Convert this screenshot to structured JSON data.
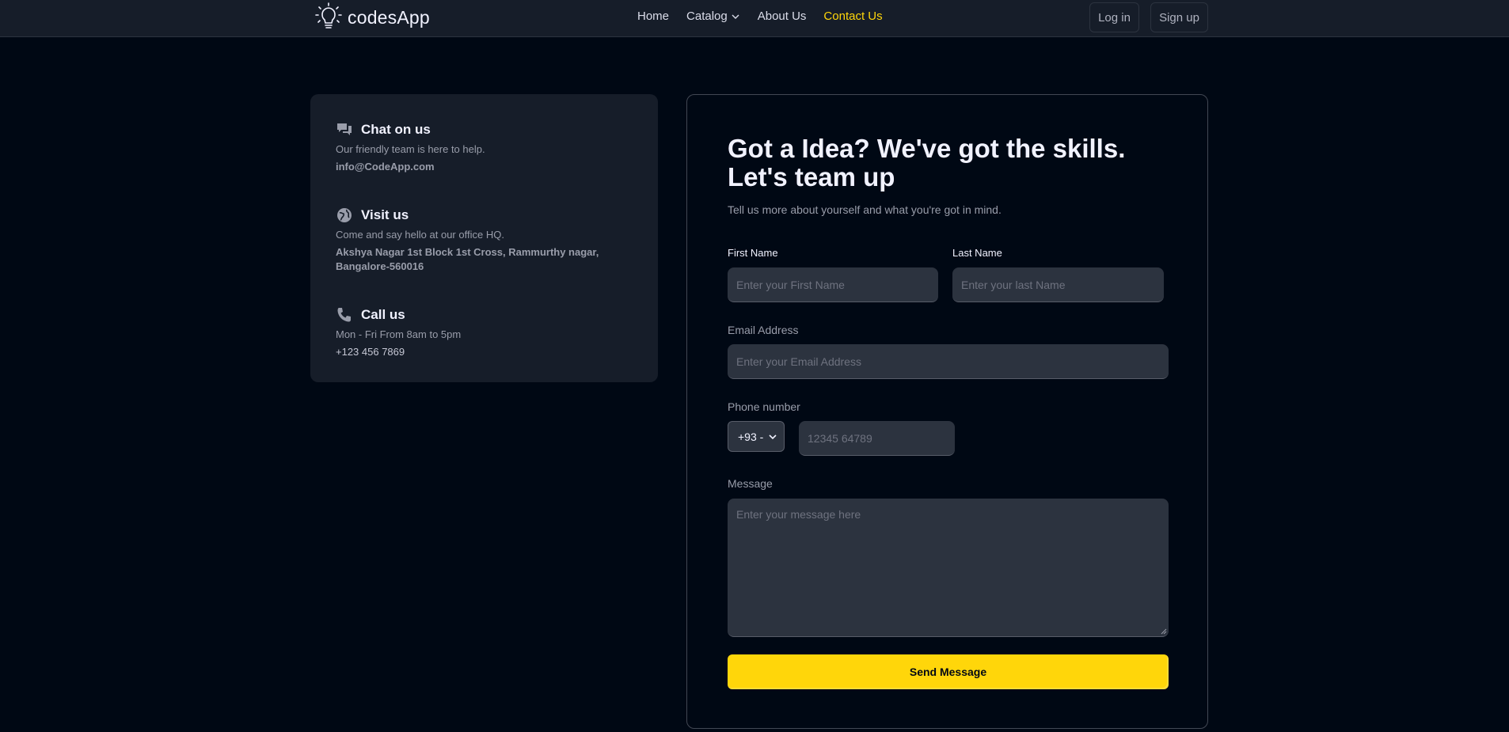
{
  "navbar": {
    "logo_text": "codesApp",
    "links": [
      {
        "label": "Home",
        "active": false
      },
      {
        "label": "Catalog",
        "active": false
      },
      {
        "label": "About Us",
        "active": false
      },
      {
        "label": "Contact Us",
        "active": true
      }
    ],
    "login_label": "Log in",
    "signup_label": "Sign up"
  },
  "info": {
    "chat": {
      "icon": "chat-icon",
      "title": "Chat on us",
      "desc": "Our friendly team is here to help.",
      "detail": "info@CodeApp.com"
    },
    "visit": {
      "icon": "globe-icon",
      "title": "Visit us",
      "desc": "Come and say hello at our office HQ.",
      "detail": "Akshya Nagar 1st Block 1st Cross, Rammurthy nagar, Bangalore-560016"
    },
    "call": {
      "icon": "phone-icon",
      "title": "Call us",
      "desc": "Mon - Fri From 8am to 5pm",
      "detail": "+123 456 7869"
    }
  },
  "form": {
    "heading": "Got a Idea? We've got the skills. Let's team up",
    "subheading": "Tell us more about yourself and what you're got in mind.",
    "first_name_label": "First Name",
    "first_name_placeholder": "Enter your First Name",
    "last_name_label": "Last Name",
    "last_name_placeholder": "Enter your last Name",
    "email_label": "Email Address",
    "email_placeholder": "Enter your Email Address",
    "phone_label": "Phone number",
    "country_code": "+93 -",
    "phone_placeholder": "12345 64789",
    "message_label": "Message",
    "message_placeholder": "Enter your message here",
    "submit_label": "Send Message"
  },
  "colors": {
    "background": "#000814",
    "card": "#161d29",
    "input": "#2c333f",
    "accent": "#ffd60a"
  }
}
